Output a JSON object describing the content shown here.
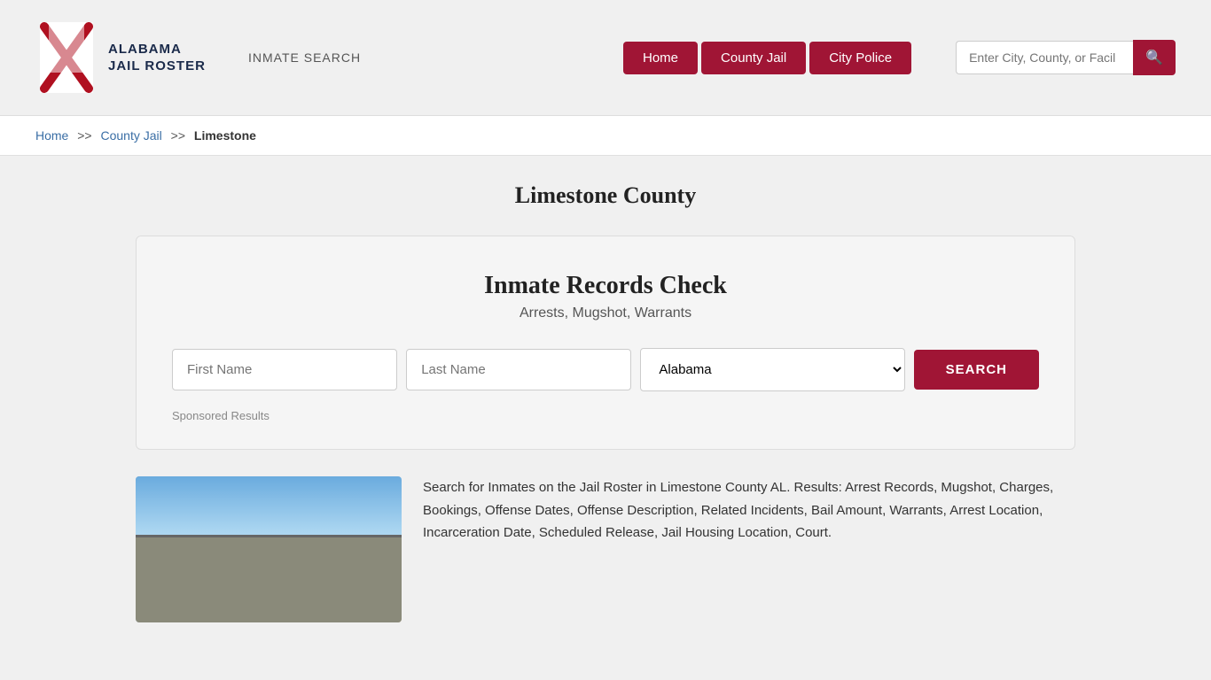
{
  "header": {
    "logo_text_line1": "ALABAMA",
    "logo_text_line2": "JAIL ROSTER",
    "inmate_search_label": "INMATE SEARCH",
    "nav": {
      "home_label": "Home",
      "county_jail_label": "County Jail",
      "city_police_label": "City Police"
    },
    "search_placeholder": "Enter City, County, or Facil"
  },
  "breadcrumb": {
    "home_label": "Home",
    "sep1": ">>",
    "county_jail_label": "County Jail",
    "sep2": ">>",
    "current_label": "Limestone"
  },
  "page_title": "Limestone County",
  "records_box": {
    "title": "Inmate Records Check",
    "subtitle": "Arrests, Mugshot, Warrants",
    "first_name_placeholder": "First Name",
    "last_name_placeholder": "Last Name",
    "state_default": "Alabama",
    "search_btn_label": "SEARCH",
    "sponsored_label": "Sponsored Results"
  },
  "description": "Search for Inmates on the Jail Roster in Limestone County AL. Results: Arrest Records, Mugshot, Charges, Bookings, Offense Dates, Offense Description, Related Incidents, Bail Amount, Warrants, Arrest Location, Incarceration Date, Scheduled Release, Jail Housing Location, Court.",
  "colors": {
    "brand_red": "#a01535",
    "link_blue": "#3a6ea5"
  }
}
